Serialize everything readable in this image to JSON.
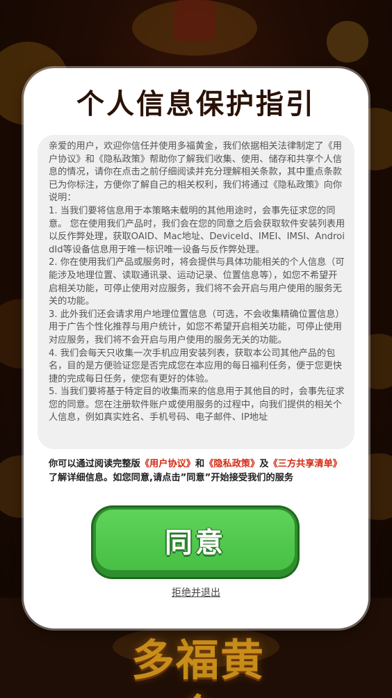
{
  "dialog": {
    "title": "个人信息保护指引",
    "policy_text": "亲爱的用户，欢迎你信任并使用多福黄金，我们依据相关法律制定了《用户协议》和《隐私政策》帮助你了解我们收集、使用、储存和共享个人信息的情况，请你在点击之前仔细阅读并充分理解相关条款，其中重点条款已为你标注，方便你了解自己的相关权利，我们将通过《隐私政策》向你说明：\n1. 当我们要将信息用于本策略未载明的其他用途时，会事先征求您的同意。 您在使用我们产品时，我们会在您的同意之后会获取软件安装列表用以反作弊处理，获取OAID、Mac地址、DeviceId、IMEI、IMSI、AndroidId等设备信息用于唯一标识唯一设备与反作弊处理。\n2. 你在使用我们产品或服务时，将会提供与具体功能相关的个人信息（可能涉及地理位置、读取通讯录、运动记录、位置信息等），如您不希望开启相关功能，可停止使用对应服务，我们将不会开启与用户使用的服务无关的功能。\n3. 此外我们还会请求用户地理位置信息（可选，不会收集精确位置信息）用于广告个性化推荐与用户统计，如您不希望开启相关功能，可停止使用对应服务，我们将不会开启与用户使用的服务无关的功能。\n4. 我们会每天只收集一次手机应用安装列表，获取本公司其他产品的包名，目的是方便验证您是否完成您在本应用的每日福利任务，便于您更快捷的完成每日任务，使您有更好的体验。\n5. 当我们要将基于特定目的收集而来的信息用于其他目的时，会事先征求您的同意。您在注册软件账户或使用服务的过程中，向我们提供的相关个人信息，例如真实姓名、手机号码、电子邮件、IP地址",
    "notice": {
      "prefix": "你可以通过阅读完整版",
      "link_user_agreement": "《用户协议》",
      "and": "和",
      "link_privacy_policy": "《隐私政策》",
      "and2": "及",
      "link_third_party": "《三方共享清单》",
      "suffix": "了解详细信息。如您同意,请点击”同意”开始接受我们的服务"
    },
    "agree_label": "同意",
    "refuse_label": "拒绝并退出"
  },
  "background": {
    "logo_text": "多福黄金"
  },
  "colors": {
    "accent_green": "#47c044",
    "link_red": "#d42a14",
    "title_brown": "#2a1206"
  }
}
